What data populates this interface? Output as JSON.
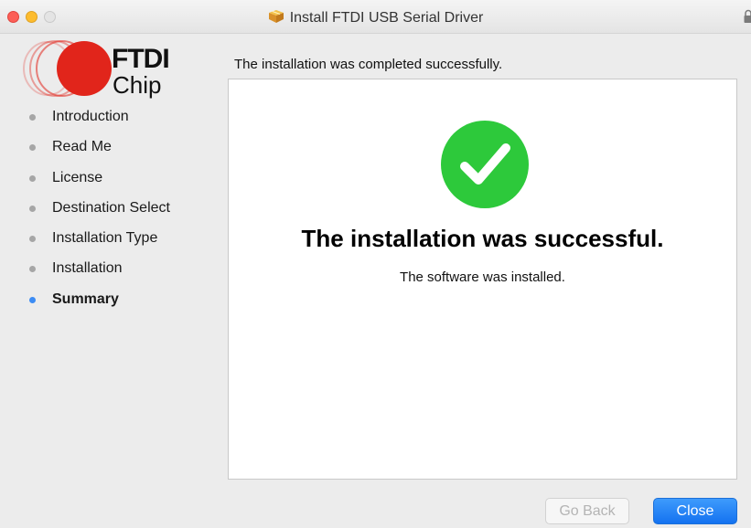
{
  "window": {
    "title": "Install FTDI USB Serial Driver"
  },
  "logo": {
    "brand": "FTDI",
    "sub": "Chip"
  },
  "sidebar": {
    "steps": [
      {
        "label": "Introduction",
        "active": false
      },
      {
        "label": "Read Me",
        "active": false
      },
      {
        "label": "License",
        "active": false
      },
      {
        "label": "Destination Select",
        "active": false
      },
      {
        "label": "Installation Type",
        "active": false
      },
      {
        "label": "Installation",
        "active": false
      },
      {
        "label": "Summary",
        "active": true
      }
    ]
  },
  "main": {
    "heading": "The installation was completed successfully.",
    "result_title": "The installation was successful.",
    "result_detail": "The software was installed."
  },
  "buttons": {
    "back_label": "Go Back",
    "close_label": "Close"
  },
  "colors": {
    "accent": "#1472f0",
    "success": "#2dc93b",
    "logo_red": "#e1251b"
  }
}
